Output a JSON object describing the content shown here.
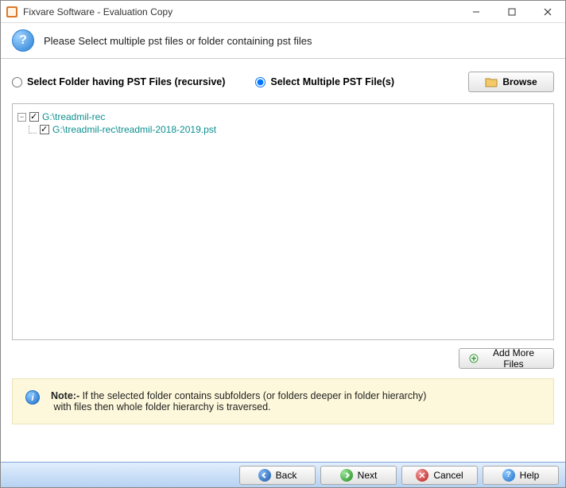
{
  "window": {
    "title": "Fixvare Software - Evaluation Copy"
  },
  "header": {
    "instruction": "Please Select multiple pst files or folder containing pst files"
  },
  "options": {
    "folder_label": "Select Folder having PST Files (recursive)",
    "multiple_label": "Select Multiple PST File(s)",
    "selected": "multiple",
    "browse_label": "Browse"
  },
  "tree": {
    "root": {
      "label": "G:\\treadmil-rec",
      "checked": true,
      "children": [
        {
          "label": "G:\\treadmil-rec\\treadmil-2018-2019.pst",
          "checked": true
        }
      ]
    }
  },
  "add_more": {
    "label": "Add More Files"
  },
  "note": {
    "prefix": "Note:-",
    "text1": " If the selected folder contains subfolders (or folders deeper in folder hierarchy)",
    "text2": "with files then whole folder hierarchy is traversed."
  },
  "footer": {
    "back": "Back",
    "next": "Next",
    "cancel": "Cancel",
    "help": "Help"
  }
}
